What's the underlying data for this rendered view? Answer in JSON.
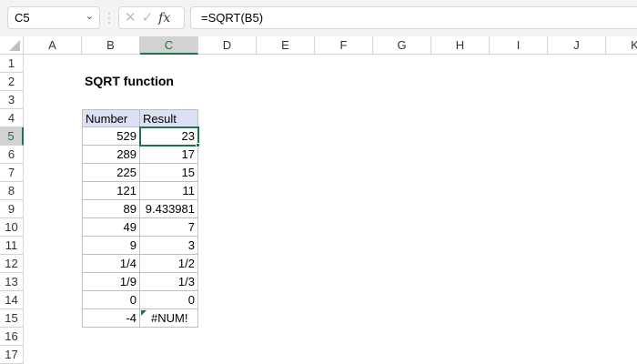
{
  "formula_bar": {
    "name_box": "C5",
    "formula": "=SQRT(B5)",
    "fx": "fx",
    "cancel": "✕",
    "enter": "✓"
  },
  "columns": [
    "A",
    "B",
    "C",
    "D",
    "E",
    "F",
    "G",
    "H",
    "I",
    "J",
    "K"
  ],
  "rows": [
    "1",
    "2",
    "3",
    "4",
    "5",
    "6",
    "7",
    "8",
    "9",
    "10",
    "11",
    "12",
    "13",
    "14",
    "15",
    "16",
    "17"
  ],
  "selected_cell": "C5",
  "title": "SQRT function",
  "table": {
    "headers": [
      "Number",
      "Result"
    ],
    "rows": [
      [
        "529",
        "23"
      ],
      [
        "289",
        "17"
      ],
      [
        "225",
        "15"
      ],
      [
        "121",
        "11"
      ],
      [
        "89",
        "9.433981"
      ],
      [
        "49",
        "7"
      ],
      [
        "9",
        "3"
      ],
      [
        "1/4",
        "1/2"
      ],
      [
        "1/9",
        "1/3"
      ],
      [
        "0",
        "0"
      ],
      [
        "-4",
        "#NUM!"
      ]
    ]
  },
  "colors": {
    "accent": "#217346",
    "header_fill": "#d9e1f2"
  }
}
